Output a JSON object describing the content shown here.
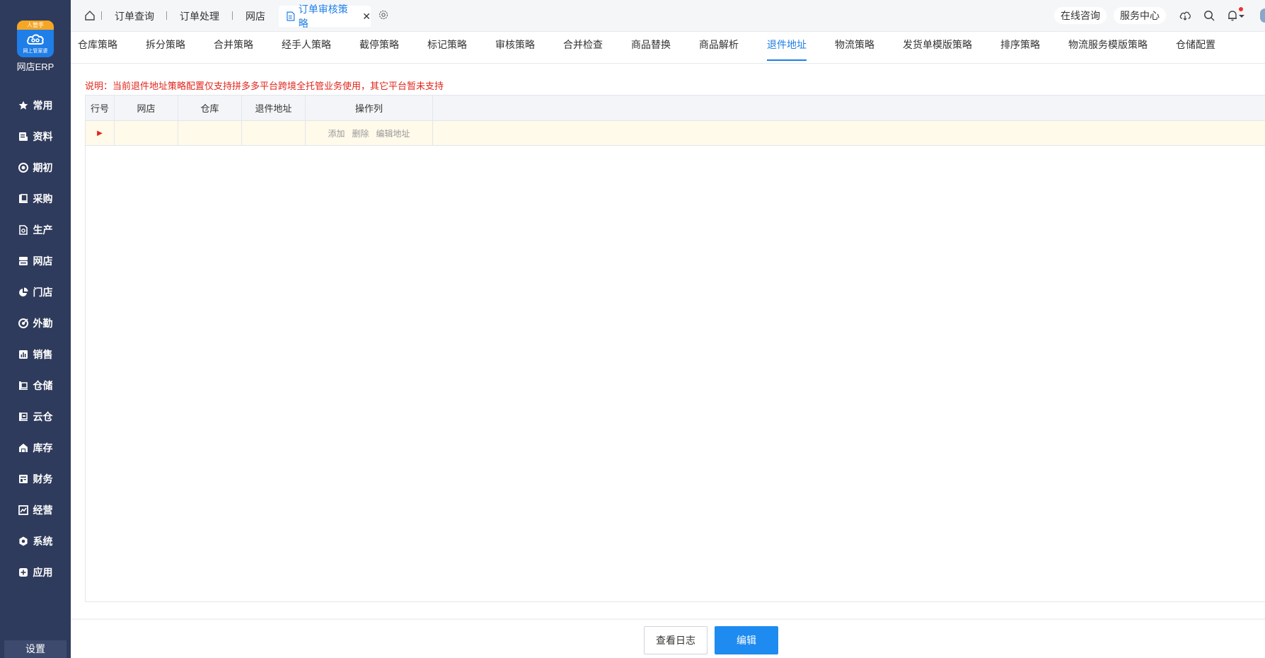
{
  "sidebar": {
    "logo_ribbon": "人管手",
    "logo_sub": "网上管家婆",
    "brand": "网店ERP",
    "items": [
      {
        "label": "常用",
        "icon": "star-icon"
      },
      {
        "label": "资料",
        "icon": "document-icon"
      },
      {
        "label": "期初",
        "icon": "target-icon"
      },
      {
        "label": "采购",
        "icon": "purchase-icon"
      },
      {
        "label": "生产",
        "icon": "production-icon"
      },
      {
        "label": "网店",
        "icon": "store-icon"
      },
      {
        "label": "门店",
        "icon": "pie-icon"
      },
      {
        "label": "外勤",
        "icon": "fieldwork-icon"
      },
      {
        "label": "销售",
        "icon": "sales-icon"
      },
      {
        "label": "仓储",
        "icon": "warehouse-icon"
      },
      {
        "label": "云仓",
        "icon": "cloud-warehouse-icon"
      },
      {
        "label": "库存",
        "icon": "inventory-icon"
      },
      {
        "label": "财务",
        "icon": "finance-icon"
      },
      {
        "label": "经营",
        "icon": "business-icon"
      },
      {
        "label": "系统",
        "icon": "system-icon"
      },
      {
        "label": "应用",
        "icon": "apps-icon"
      }
    ],
    "settings": "设置"
  },
  "topbar": {
    "tabs": [
      "订单查询",
      "订单处理",
      "网店"
    ],
    "active_tab": "订单审核策略",
    "close": "✕",
    "online_consult": "在线咨询",
    "service_center": "服务中心"
  },
  "subtabs": {
    "items": [
      "仓库策略",
      "拆分策略",
      "合并策略",
      "经手人策略",
      "截停策略",
      "标记策略",
      "审核策略",
      "合并检查",
      "商品替换",
      "商品解析",
      "退件地址",
      "物流策略",
      "发货单模版策略",
      "排序策略",
      "物流服务模版策略",
      "仓储配置"
    ],
    "active_index": 10
  },
  "notice": "说明：当前退件地址策略配置仅支持拼多多平台跨境全托管业务使用，其它平台暂未支持",
  "grid": {
    "columns": [
      "行号",
      "网店",
      "仓库",
      "退件地址",
      "操作列"
    ],
    "row": {
      "marker": "▶",
      "actions": [
        "添加",
        "删除",
        "编辑地址"
      ]
    }
  },
  "footer": {
    "view_log": "查看日志",
    "edit": "编辑"
  },
  "colors": {
    "sidebar_bg": "#2f3b5c",
    "accent": "#1e7ee6",
    "notice_red": "#e1251b",
    "primary_button": "#1e8bf0",
    "selected_row": "#fffaea"
  }
}
